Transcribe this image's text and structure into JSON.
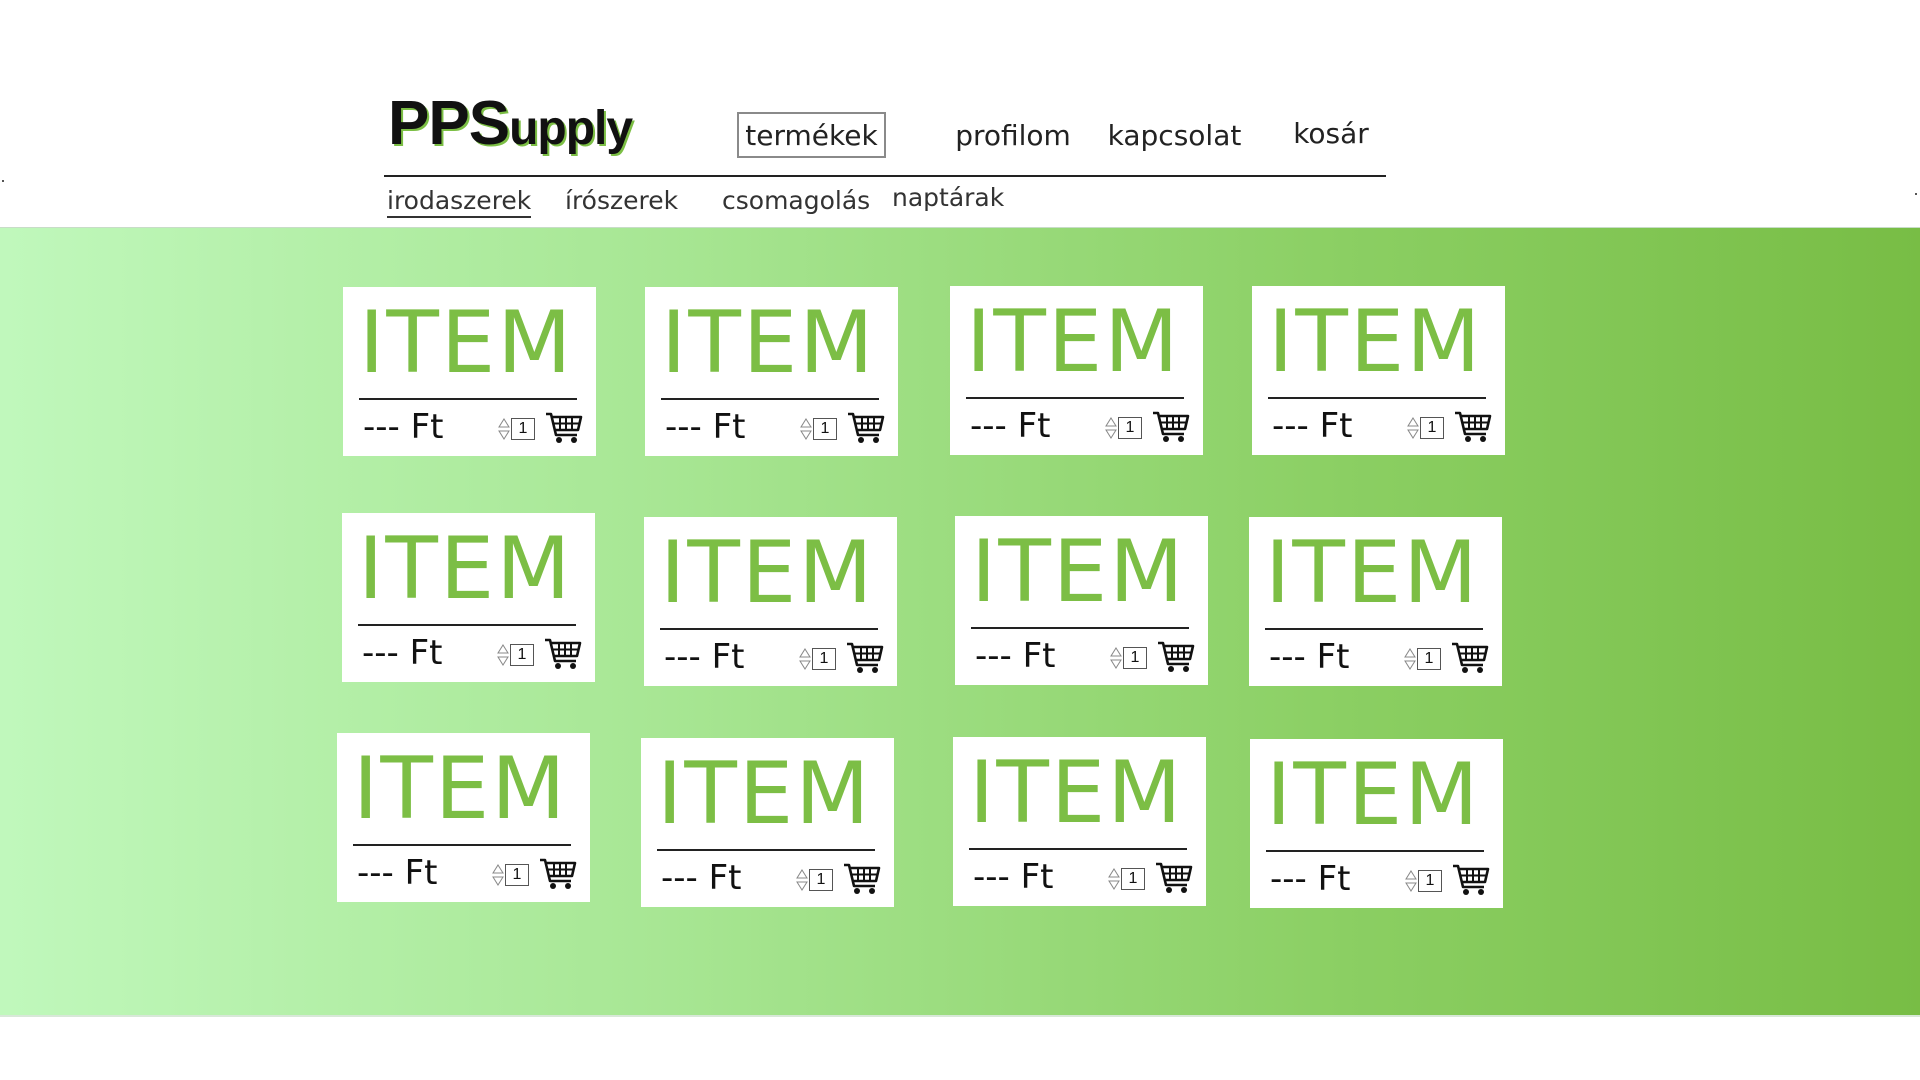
{
  "brand": {
    "logo_big": "PPS",
    "logo_small": "upply"
  },
  "nav": {
    "items": [
      {
        "label": "termékek",
        "active": true
      },
      {
        "label": "profilom",
        "active": false
      },
      {
        "label": "kapcsolat",
        "active": false
      },
      {
        "label": "kosár",
        "active": false
      }
    ]
  },
  "categories": {
    "items": [
      {
        "label": "irodaszerek",
        "active": true
      },
      {
        "label": "írószerek",
        "active": false
      },
      {
        "label": "csomagolás",
        "active": false
      },
      {
        "label": "naptárak",
        "active": false
      }
    ]
  },
  "products": [
    {
      "name": "ITEM",
      "price": "--- Ft",
      "qty": "1"
    },
    {
      "name": "ITEM",
      "price": "--- Ft",
      "qty": "1"
    },
    {
      "name": "ITEM",
      "price": "--- Ft",
      "qty": "1"
    },
    {
      "name": "ITEM",
      "price": "--- Ft",
      "qty": "1"
    },
    {
      "name": "ITEM",
      "price": "--- Ft",
      "qty": "1"
    },
    {
      "name": "ITEM",
      "price": "--- Ft",
      "qty": "1"
    },
    {
      "name": "ITEM",
      "price": "--- Ft",
      "qty": "1"
    },
    {
      "name": "ITEM",
      "price": "--- Ft",
      "qty": "1"
    },
    {
      "name": "ITEM",
      "price": "--- Ft",
      "qty": "1"
    },
    {
      "name": "ITEM",
      "price": "--- Ft",
      "qty": "1"
    },
    {
      "name": "ITEM",
      "price": "--- Ft",
      "qty": "1"
    },
    {
      "name": "ITEM",
      "price": "--- Ft",
      "qty": "1"
    }
  ],
  "icons": {
    "cart": "shopping-cart-icon",
    "spinner": "up-down-arrows-icon"
  },
  "colors": {
    "accent": "#7cbe45",
    "gradient_start": "#c0f8bc",
    "gradient_end": "#78bd45"
  }
}
